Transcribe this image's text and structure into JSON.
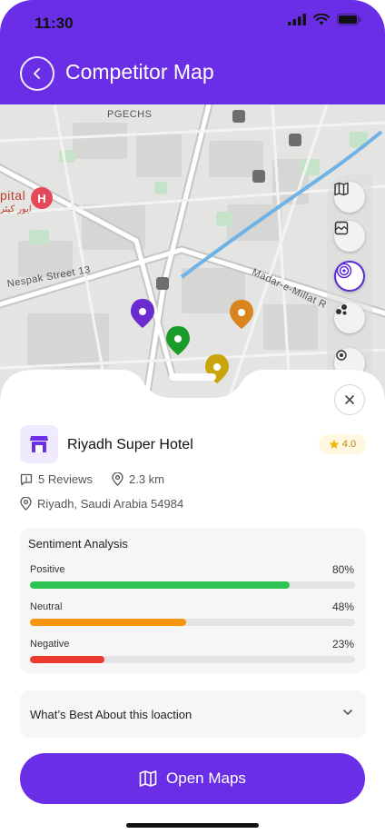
{
  "status_bar": {
    "time": "11:30"
  },
  "header": {
    "title": "Competitor Map"
  },
  "map": {
    "labels": {
      "district": "PGECHS",
      "hospital_en": "pital",
      "hospital_ur": "ایور کیئر",
      "street_1": "Nespak Street 13",
      "street_2": "Madar-e-Millat R"
    },
    "controls": [
      "map-layers-icon",
      "satellite-icon",
      "radar-icon",
      "cluster-icon",
      "locate-icon"
    ],
    "active_control": "radar-icon"
  },
  "hotel": {
    "name": "Riyadh Super Hotel",
    "rating": "4.0",
    "reviews": "5 Reviews",
    "distance": "2.3 km",
    "address": "Riyadh, Saudi Arabia 54984"
  },
  "sentiment": {
    "title": "Sentiment Analysis",
    "items": [
      {
        "label": "Positive",
        "percent_text": "80%",
        "value": 0.8,
        "color": "#2fc353"
      },
      {
        "label": "Neutral",
        "percent_text": "48%",
        "value": 0.48,
        "color": "#f7950f"
      },
      {
        "label": "Negative",
        "percent_text": "23%",
        "value": 0.23,
        "color": "#ef3a30"
      }
    ]
  },
  "accordion": {
    "label": "What’s Best About this loaction"
  },
  "primary_button": {
    "label": "Open Maps"
  },
  "colors": {
    "brand": "#6a2ee6",
    "star": "#f2b705"
  }
}
